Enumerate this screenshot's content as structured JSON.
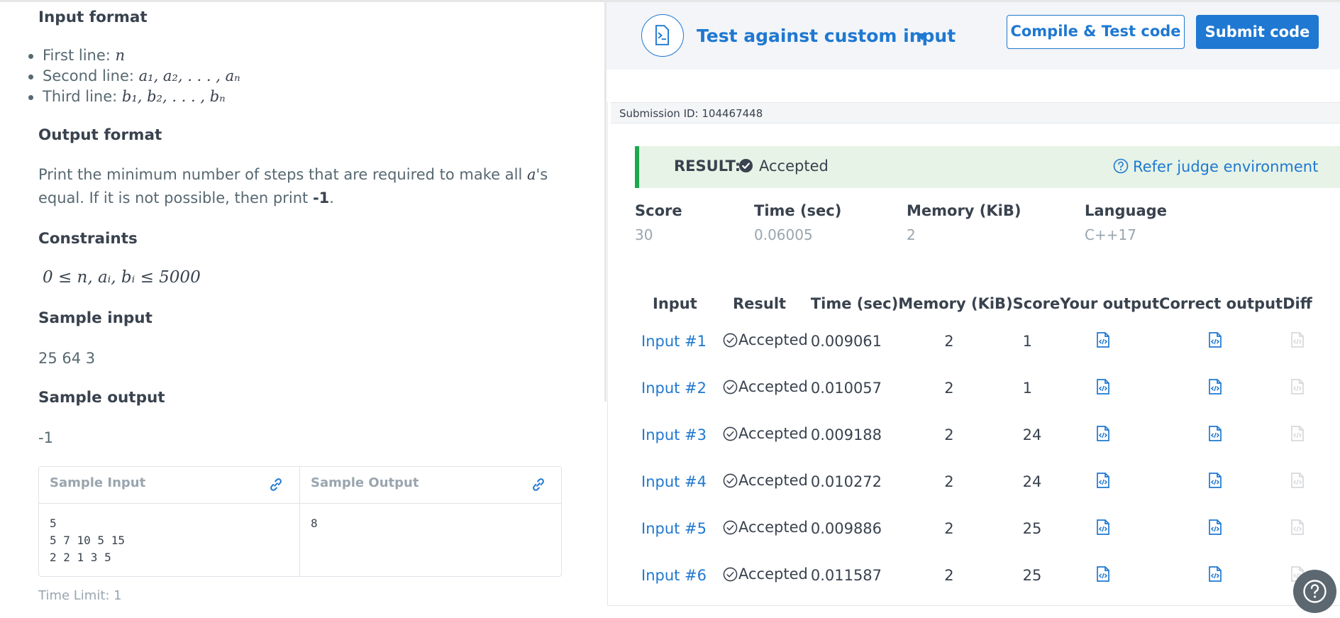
{
  "left": {
    "input_format_heading": "Input format",
    "input_lines": [
      {
        "label": "First line:",
        "math": "n"
      },
      {
        "label": "Second line:",
        "math": "a₁, a₂, . . . , aₙ"
      },
      {
        "label": "Third line:",
        "math": "b₁, b₂, . . . , bₙ"
      }
    ],
    "output_format_heading": "Output format",
    "output_text_1": "Print the minimum number of steps that are required to make all ",
    "output_math": "a",
    "output_text_2": "'s",
    "output_text_3": "equal. If it is not possible, then print ",
    "output_bold": "-1",
    "output_text_4": ".",
    "constraints_heading": "Constraints",
    "constraints_math": "0 ≤ n, aᵢ, bᵢ ≤ 5000",
    "sample_input_heading": "Sample input",
    "sample_input_value": "25 64 3",
    "sample_output_heading": "Sample output",
    "sample_output_value": "-1",
    "sample_table": {
      "input_header": "Sample Input",
      "output_header": "Sample Output",
      "input_body": "5\n5 7 10 5 15\n2 2 1 3 5",
      "output_body": "8"
    },
    "time_limit": "Time Limit: 1"
  },
  "right": {
    "test_label": "Test against custom input",
    "compile_button": "Compile & Test code",
    "submit_button": "Submit code",
    "submission_id": "Submission ID: 104467448",
    "result_label": "RESULT:",
    "result_value": "Accepted",
    "refer_link": "Refer judge environment",
    "stats": [
      {
        "key": "Score",
        "value": "30"
      },
      {
        "key": "Time (sec)",
        "value": "0.06005"
      },
      {
        "key": "Memory (KiB)",
        "value": "2"
      },
      {
        "key": "Language",
        "value": "C++17"
      }
    ],
    "table_headers": [
      "Input",
      "Result",
      "Time (sec)",
      "Memory (KiB)",
      "Score",
      "Your output",
      "Correct output",
      "Diff"
    ],
    "rows": [
      {
        "input": "Input #1",
        "result": "Accepted",
        "time": "0.009061",
        "memory": "2",
        "score": "1"
      },
      {
        "input": "Input #2",
        "result": "Accepted",
        "time": "0.010057",
        "memory": "2",
        "score": "1"
      },
      {
        "input": "Input #3",
        "result": "Accepted",
        "time": "0.009188",
        "memory": "2",
        "score": "24"
      },
      {
        "input": "Input #4",
        "result": "Accepted",
        "time": "0.010272",
        "memory": "2",
        "score": "24"
      },
      {
        "input": "Input #5",
        "result": "Accepted",
        "time": "0.009886",
        "memory": "2",
        "score": "25"
      },
      {
        "input": "Input #6",
        "result": "Accepted",
        "time": "0.011587",
        "memory": "2",
        "score": "25"
      }
    ]
  },
  "colors": {
    "accent": "#1f78d1",
    "success": "#1ba94c",
    "result_bg": "#e6f3e6"
  }
}
